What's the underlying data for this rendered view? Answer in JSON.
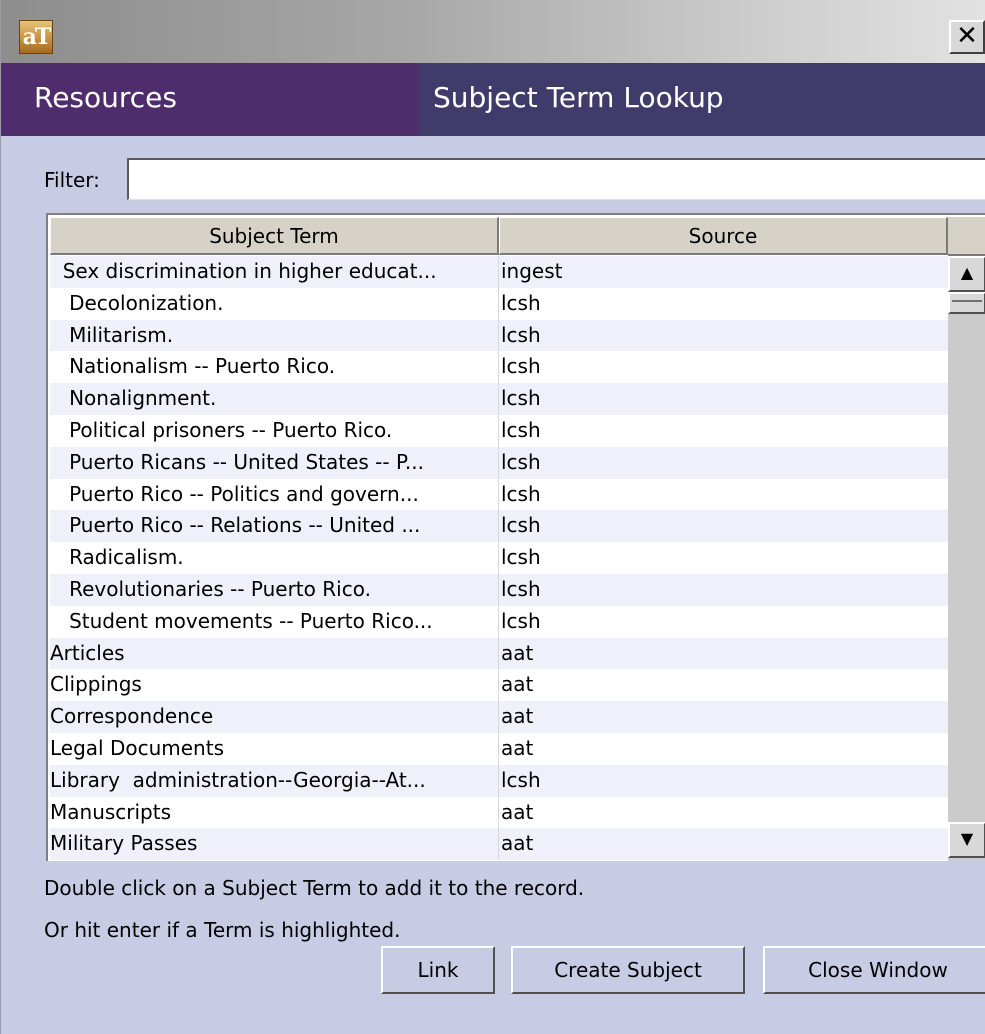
{
  "window": {
    "app_icon_text": "aT",
    "close_label": "✕"
  },
  "header": {
    "left_title": "Resources",
    "right_title": "Subject Term Lookup"
  },
  "filter": {
    "label": "Filter:",
    "value": ""
  },
  "table": {
    "columns": [
      "Subject Term",
      "Source"
    ],
    "rows": [
      {
        "term": "  Sex discrimination in higher educat...",
        "source": "ingest"
      },
      {
        "term": "   Decolonization.",
        "source": "lcsh"
      },
      {
        "term": "   Militarism.",
        "source": "lcsh"
      },
      {
        "term": "   Nationalism -- Puerto Rico.",
        "source": "lcsh"
      },
      {
        "term": "   Nonalignment.",
        "source": "lcsh"
      },
      {
        "term": "   Political prisoners -- Puerto Rico.",
        "source": "lcsh"
      },
      {
        "term": "   Puerto Ricans -- United States -- P...",
        "source": "lcsh"
      },
      {
        "term": "   Puerto Rico -- Politics and govern...",
        "source": "lcsh"
      },
      {
        "term": "   Puerto Rico -- Relations -- United ...",
        "source": "lcsh"
      },
      {
        "term": "   Radicalism.",
        "source": "lcsh"
      },
      {
        "term": "   Revolutionaries -- Puerto Rico.",
        "source": "lcsh"
      },
      {
        "term": "   Student movements -- Puerto Rico...",
        "source": "lcsh"
      },
      {
        "term": "Articles",
        "source": "aat"
      },
      {
        "term": "Clippings",
        "source": "aat"
      },
      {
        "term": "Correspondence",
        "source": "aat"
      },
      {
        "term": "Legal Documents",
        "source": "aat"
      },
      {
        "term": "Library  administration--Georgia--At...",
        "source": "lcsh"
      },
      {
        "term": "Manuscripts",
        "source": "aat"
      },
      {
        "term": "Military Passes",
        "source": "aat"
      }
    ]
  },
  "scrollbar": {
    "up_glyph": "▲",
    "down_glyph": "▼"
  },
  "hints": {
    "line1": "Double click on a Subject Term to add it to the record.",
    "line2": "Or hit enter if a Term is highlighted."
  },
  "buttons": {
    "link": "Link",
    "create": "Create Subject",
    "close": "Close Window"
  },
  "colors": {
    "header_left": "#4f2d6c",
    "header_right": "#3f3b6a",
    "panel": "#c7cbe4"
  }
}
